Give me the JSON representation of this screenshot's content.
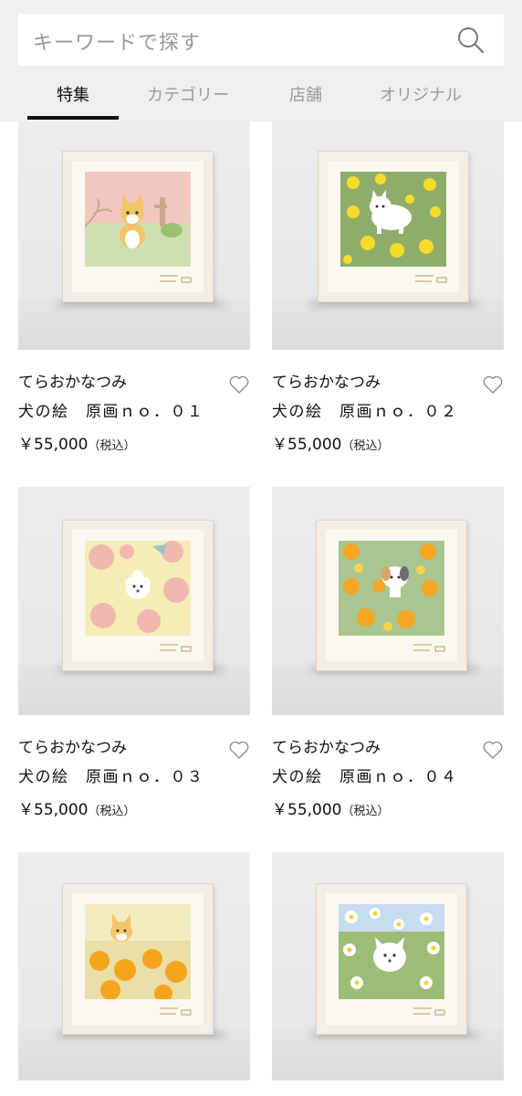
{
  "search": {
    "placeholder": "キーワードで探す"
  },
  "tabs": [
    "特集",
    "カテゴリー",
    "店舗",
    "オリジナル"
  ],
  "active_tab": "特集",
  "products": [
    {
      "artist": "てらおかなつみ",
      "title": "犬の絵　原画ｎｏ．０１",
      "price": "￥55,000",
      "tax": "（税込）"
    },
    {
      "artist": "てらおかなつみ",
      "title": "犬の絵　原画ｎｏ．０２",
      "price": "￥55,000",
      "tax": "（税込）"
    },
    {
      "artist": "てらおかなつみ",
      "title": "犬の絵　原画ｎｏ．０３",
      "price": "￥55,000",
      "tax": "（税込）"
    },
    {
      "artist": "てらおかなつみ",
      "title": "犬の絵　原画ｎｏ．０４",
      "price": "￥55,000",
      "tax": "（税込）"
    },
    {
      "artist": "",
      "title": "",
      "price": "",
      "tax": ""
    },
    {
      "artist": "",
      "title": "",
      "price": "",
      "tax": ""
    }
  ],
  "colors": {
    "header_bg": "#efefef",
    "active_tab": "#111111",
    "inactive_tab": "#9a9a9a"
  }
}
